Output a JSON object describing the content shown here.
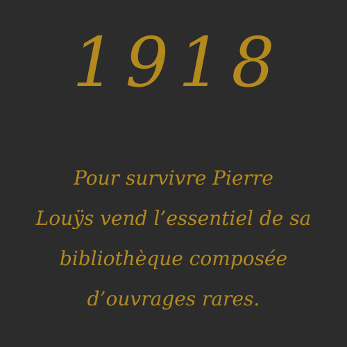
{
  "card": {
    "year": "1918",
    "description_lines": [
      "Pour survivre Pierre",
      "Louÿs vend l’essentiel de sa",
      "bibliothèque composée",
      "d’ouvrages rares."
    ],
    "colors": {
      "background": "#2c2c2c",
      "text_gold": "#b48a1e"
    }
  }
}
